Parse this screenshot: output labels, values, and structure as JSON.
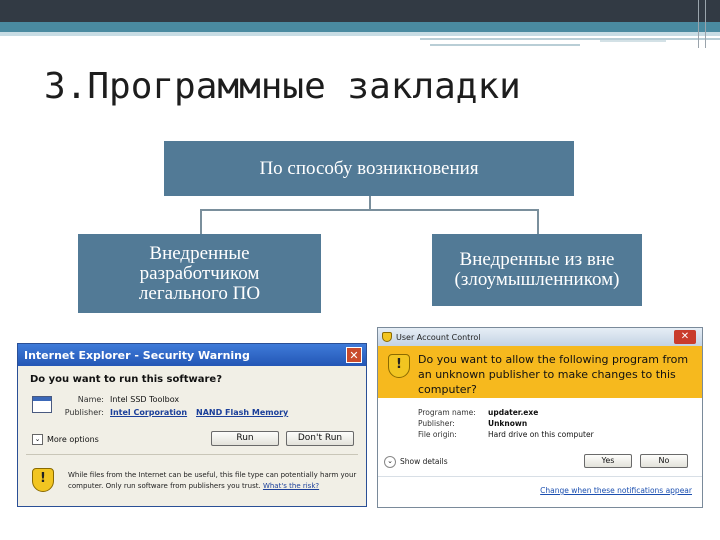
{
  "slide": {
    "title": "3.Программные закладки"
  },
  "diagram": {
    "root": "По способу возникновения",
    "child_left": "Внедренные разработчиком легального ПО",
    "child_right": "Внедренные из вне (злоумышленником)"
  },
  "ie_dialog": {
    "title": "Internet Explorer - Security Warning",
    "question": "Do you want to run this software?",
    "name_label": "Name:",
    "name_value": "Intel SSD Toolbox",
    "publisher_label": "Publisher:",
    "publisher_value": "Intel Corporation",
    "publisher_extra": "NAND Flash Memory",
    "run_label": "Run",
    "dont_run_label": "Don't Run",
    "more_options": "More options",
    "warning_text": "While files from the Internet can be useful, this file type can potentially harm your computer. Only run software from publishers you trust.",
    "risk_link": "What's the risk?",
    "close_glyph": "✕"
  },
  "uac_dialog": {
    "title": "User Account Control",
    "question": "Do you want to allow the following program from an unknown publisher to make changes to this computer?",
    "program_name_label": "Program name:",
    "program_name_value": "updater.exe",
    "publisher_label": "Publisher:",
    "publisher_value": "Unknown",
    "file_origin_label": "File origin:",
    "file_origin_value": "Hard drive on this computer",
    "show_details": "Show details",
    "yes_label": "Yes",
    "no_label": "No",
    "change_link": "Change when these notifications appear",
    "close_glyph": "✕"
  },
  "colors": {
    "box_fill": "#527a96",
    "header_dark": "#323a44",
    "header_teal": "#4a8aa0"
  }
}
